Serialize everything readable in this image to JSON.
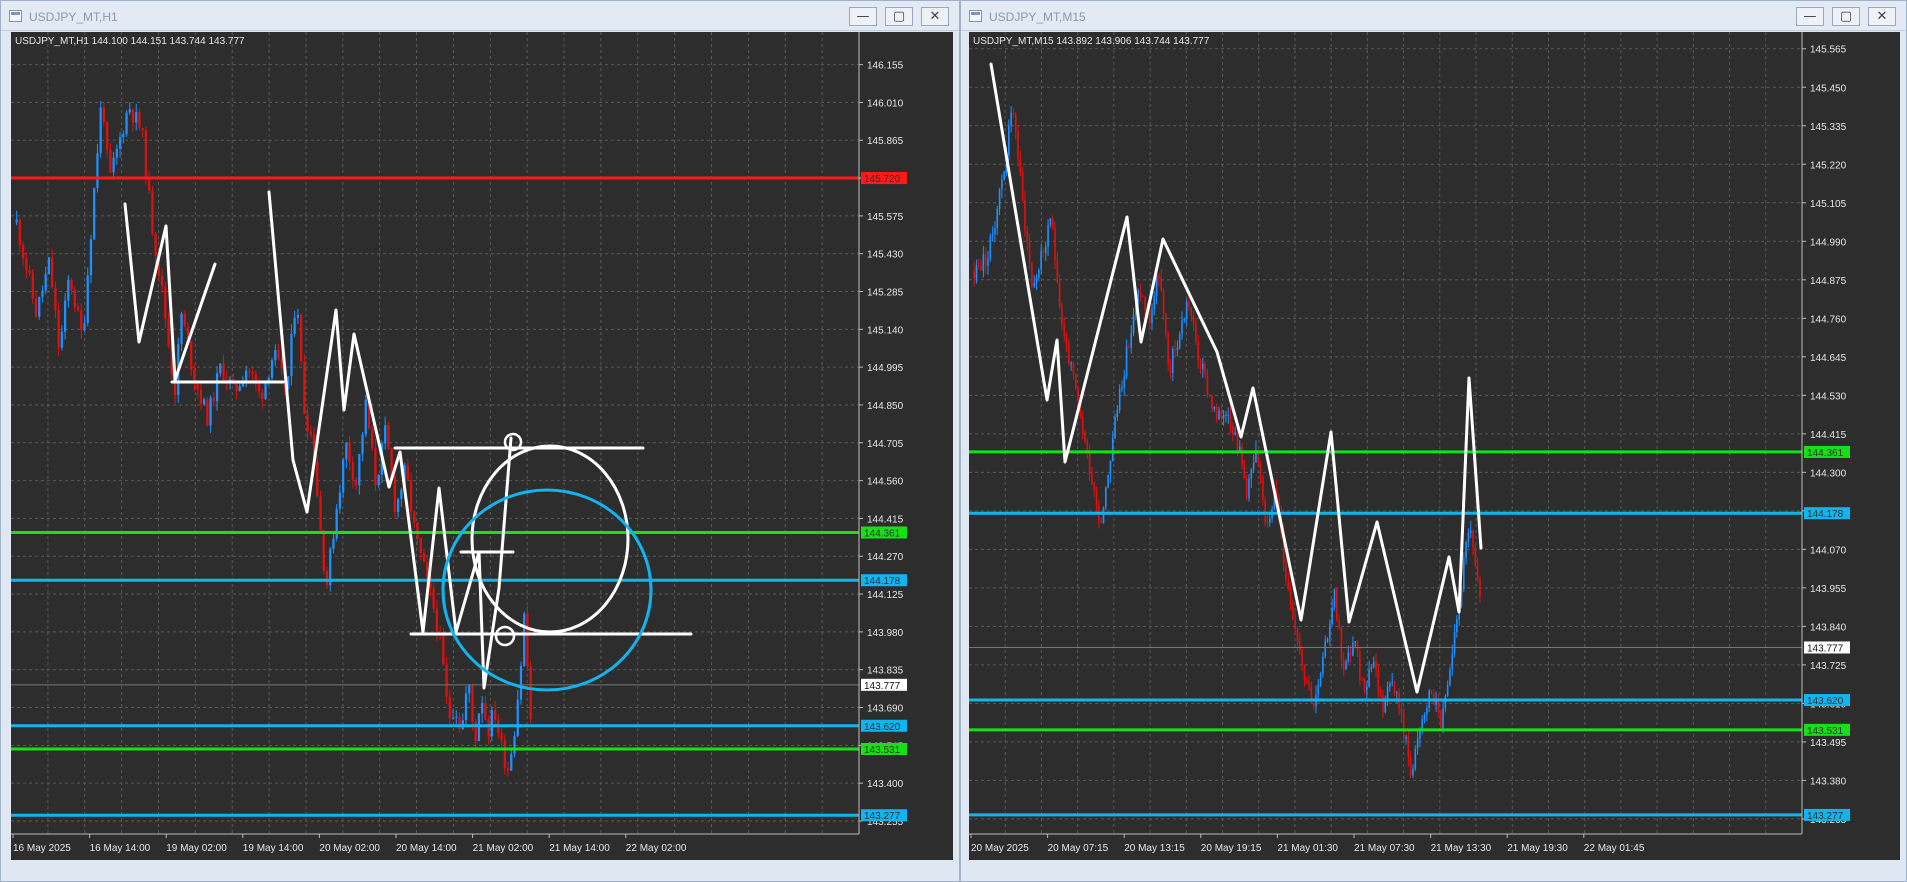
{
  "windows": [
    {
      "title": "USDJPY_MT,H1",
      "header": "USDJPY_MT,H1  144.100 144.151 143.744 143.777",
      "buttons": {
        "minimize": "—",
        "maximize": "▢",
        "close": "✕"
      }
    },
    {
      "title": "USDJPY_MT,M15",
      "header": "USDJPY_MT,M15  143.892 143.906 143.744 143.777",
      "buttons": {
        "minimize": "—",
        "maximize": "▢",
        "close": "✕"
      }
    }
  ],
  "colors": {
    "background": "#2d2d2d",
    "grid": "#5a5a5a",
    "bull": "#1e90ff",
    "bear": "#e01010",
    "drawing": "#ffffff",
    "line_red": "#ff1a1a",
    "line_green": "#16e016",
    "line_blue": "#12b4f0",
    "current_price_label": "#ffffff"
  },
  "chart_data": [
    {
      "type": "candlestick",
      "symbol": "USDJPY_MT",
      "timeframe": "H1",
      "ohlc_header": {
        "open": 144.1,
        "high": 144.151,
        "low": 143.744,
        "close": 143.777
      },
      "y_ticks": [
        146.155,
        146.01,
        145.865,
        145.72,
        145.575,
        145.43,
        145.285,
        145.14,
        144.995,
        144.85,
        144.705,
        144.56,
        144.415,
        144.27,
        144.125,
        143.98,
        143.835,
        143.69,
        143.545,
        143.4,
        143.255
      ],
      "ylim": [
        143.205,
        146.28
      ],
      "x_labels": [
        "16 May 2025",
        "16 May 14:00",
        "19 May 02:00",
        "19 May 14:00",
        "20 May 02:00",
        "20 May 14:00",
        "21 May 02:00",
        "21 May 14:00",
        "22 May 02:00"
      ],
      "current_price": 143.777,
      "levels": [
        {
          "price": 145.72,
          "color": "red",
          "label": "145.720"
        },
        {
          "price": 144.361,
          "color": "green",
          "label": "144.361"
        },
        {
          "price": 144.178,
          "color": "blue",
          "label": "144.178"
        },
        {
          "price": 143.62,
          "color": "blue",
          "label": "143.620"
        },
        {
          "price": 143.531,
          "color": "green",
          "label": "143.531"
        },
        {
          "price": 143.277,
          "color": "blue",
          "label": "143.277"
        }
      ],
      "price_path": [
        [
          0,
          145.55
        ],
        [
          6,
          145.2
        ],
        [
          10,
          145.4
        ],
        [
          13,
          145.05
        ],
        [
          16,
          145.35
        ],
        [
          20,
          145.1
        ],
        [
          24,
          145.75
        ],
        [
          26,
          146.05
        ],
        [
          28,
          145.7
        ],
        [
          30,
          145.8
        ],
        [
          34,
          146.0
        ],
        [
          38,
          145.9
        ],
        [
          41,
          145.55
        ],
        [
          44,
          145.3
        ],
        [
          46,
          145.1
        ],
        [
          48,
          144.9
        ],
        [
          50,
          145.2
        ],
        [
          54,
          144.95
        ],
        [
          58,
          144.8
        ],
        [
          62,
          145.0
        ],
        [
          66,
          144.9
        ],
        [
          70,
          145.0
        ],
        [
          74,
          144.88
        ],
        [
          78,
          145.05
        ],
        [
          82,
          144.9
        ],
        [
          85,
          145.3
        ],
        [
          87,
          144.85
        ],
        [
          90,
          144.7
        ],
        [
          92,
          144.4
        ],
        [
          94,
          144.15
        ],
        [
          97,
          144.45
        ],
        [
          100,
          144.7
        ],
        [
          103,
          144.55
        ],
        [
          106,
          144.85
        ],
        [
          109,
          144.55
        ],
        [
          112,
          144.75
        ],
        [
          115,
          144.45
        ],
        [
          118,
          144.6
        ],
        [
          121,
          144.35
        ],
        [
          124,
          144.2
        ],
        [
          127,
          144.05
        ],
        [
          129,
          143.9
        ],
        [
          131,
          143.65
        ],
        [
          133,
          143.7
        ],
        [
          135,
          143.6
        ],
        [
          137,
          143.8
        ],
        [
          139,
          143.55
        ],
        [
          141,
          143.75
        ],
        [
          143,
          143.6
        ],
        [
          145,
          143.68
        ],
        [
          147,
          143.55
        ],
        [
          149,
          143.45
        ],
        [
          151,
          143.6
        ],
        [
          153,
          143.85
        ],
        [
          154,
          144.05
        ],
        [
          156,
          143.65
        ]
      ]
    },
    {
      "type": "candlestick",
      "symbol": "USDJPY_MT",
      "timeframe": "M15",
      "ohlc_header": {
        "open": 143.892,
        "high": 143.906,
        "low": 143.744,
        "close": 143.777
      },
      "y_ticks": [
        145.565,
        145.45,
        145.335,
        145.22,
        145.105,
        144.99,
        144.875,
        144.76,
        144.645,
        144.53,
        144.415,
        144.3,
        144.185,
        144.07,
        143.955,
        143.84,
        143.725,
        143.61,
        143.495,
        143.38,
        143.265
      ],
      "ylim": [
        143.22,
        145.615
      ],
      "x_labels": [
        "20 May 2025",
        "20 May 07:15",
        "20 May 13:15",
        "20 May 19:15",
        "21 May 01:30",
        "21 May 07:30",
        "21 May 13:30",
        "21 May 19:30",
        "22 May 01:45"
      ],
      "current_price": 143.777,
      "levels": [
        {
          "price": 144.361,
          "color": "green",
          "label": "144.361"
        },
        {
          "price": 144.178,
          "color": "blue",
          "label": "144.178"
        },
        {
          "price": 143.62,
          "color": "blue",
          "label": "143.620"
        },
        {
          "price": 143.531,
          "color": "green",
          "label": "143.531"
        },
        {
          "price": 143.277,
          "color": "blue",
          "label": "143.277"
        }
      ],
      "price_path": [
        [
          0,
          144.9
        ],
        [
          3,
          144.95
        ],
        [
          6,
          145.2
        ],
        [
          8,
          145.4
        ],
        [
          10,
          145.1
        ],
        [
          12,
          144.85
        ],
        [
          14,
          144.95
        ],
        [
          16,
          145.05
        ],
        [
          18,
          144.75
        ],
        [
          20,
          144.6
        ],
        [
          22,
          144.45
        ],
        [
          24,
          144.3
        ],
        [
          26,
          144.15
        ],
        [
          28,
          144.35
        ],
        [
          30,
          144.55
        ],
        [
          32,
          144.7
        ],
        [
          34,
          144.85
        ],
        [
          36,
          144.75
        ],
        [
          38,
          144.9
        ],
        [
          40,
          144.6
        ],
        [
          42,
          144.7
        ],
        [
          44,
          144.82
        ],
        [
          46,
          144.65
        ],
        [
          48,
          144.55
        ],
        [
          50,
          144.45
        ],
        [
          52,
          144.5
        ],
        [
          54,
          144.4
        ],
        [
          56,
          144.25
        ],
        [
          58,
          144.35
        ],
        [
          60,
          144.15
        ],
        [
          62,
          144.25
        ],
        [
          64,
          144.0
        ],
        [
          66,
          143.85
        ],
        [
          68,
          143.7
        ],
        [
          70,
          143.6
        ],
        [
          72,
          143.75
        ],
        [
          74,
          143.95
        ],
        [
          76,
          143.7
        ],
        [
          78,
          143.8
        ],
        [
          80,
          143.65
        ],
        [
          82,
          143.75
        ],
        [
          84,
          143.6
        ],
        [
          86,
          143.7
        ],
        [
          88,
          143.55
        ],
        [
          90,
          143.4
        ],
        [
          92,
          143.55
        ],
        [
          94,
          143.65
        ],
        [
          96,
          143.55
        ],
        [
          98,
          143.7
        ],
        [
          100,
          143.95
        ],
        [
          102,
          144.15
        ],
        [
          104,
          143.9
        ]
      ]
    }
  ]
}
